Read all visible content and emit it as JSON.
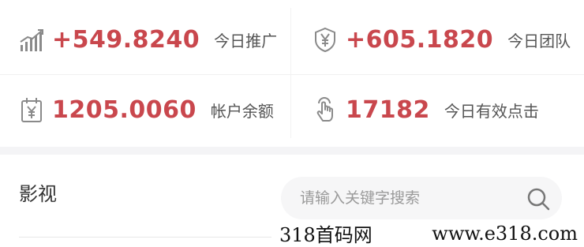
{
  "stats": [
    {
      "value": "+549.8240",
      "label": "今日推广",
      "icon": "bar-chart-icon"
    },
    {
      "value": "+605.1820",
      "label": "今日团队",
      "icon": "yen-shield-icon"
    },
    {
      "value": "1205.0060",
      "label": "帐户余额",
      "icon": "yen-calendar-icon"
    },
    {
      "value": "17182",
      "label": "今日有效点击",
      "icon": "tap-hand-icon"
    }
  ],
  "section": {
    "title": "影视",
    "search_placeholder": "请输入关键字搜索"
  },
  "watermark": {
    "left": "318首码网",
    "right": "www.e318.com"
  },
  "colors": {
    "value_red": "#c9474d",
    "label_gray": "#555555",
    "icon_gray": "#8a8a8a"
  }
}
